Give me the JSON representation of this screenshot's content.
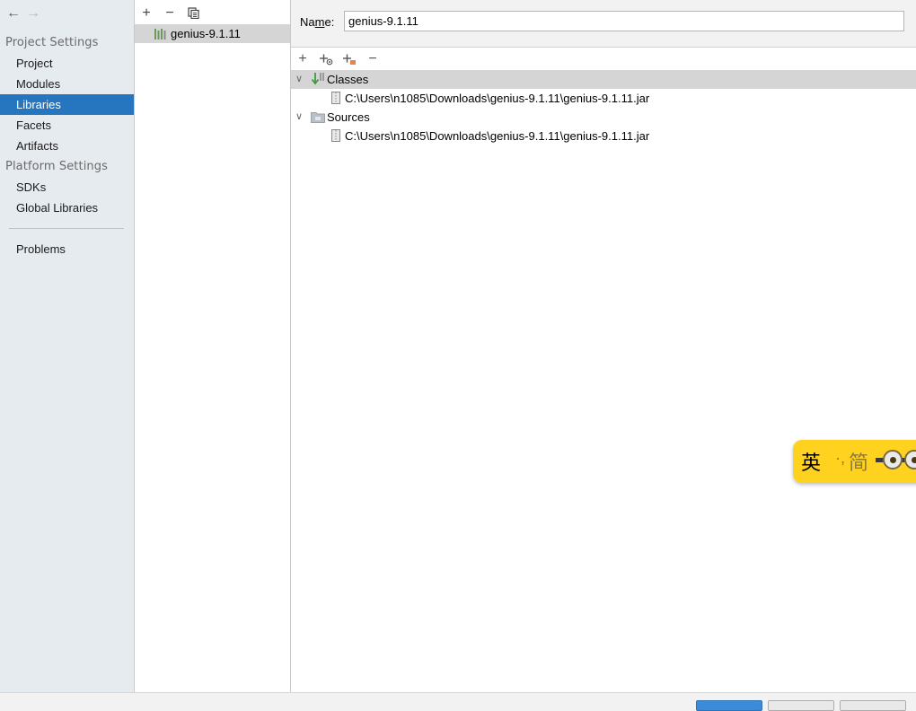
{
  "nav": {
    "back_icon": "arrow-left-icon",
    "forward_icon": "arrow-right-icon",
    "back_glyph": "←",
    "forward_glyph": "→"
  },
  "sidebar": {
    "project_settings_header": "Project Settings",
    "platform_settings_header": "Platform Settings",
    "project_items": [
      "Project",
      "Modules",
      "Libraries",
      "Facets",
      "Artifacts"
    ],
    "platform_items": [
      "SDKs",
      "Global Libraries"
    ],
    "problems": "Problems",
    "selected": "Libraries"
  },
  "libraries": {
    "toolbar": {
      "add": "+",
      "remove": "−",
      "copy_icon": "copy-icon"
    },
    "items": [
      "genius-9.1.11"
    ],
    "selected": "genius-9.1.11"
  },
  "detail": {
    "name_label_prefix": "Na",
    "name_label_mnemonic": "m",
    "name_label_suffix": "e:",
    "name_value": "genius-9.1.11",
    "toolbar": {
      "add": "+",
      "add_special_icon": "add-with-badge-icon",
      "add_orange_icon": "add-orange-icon",
      "remove": "−"
    },
    "tree": {
      "classes": {
        "label": "Classes",
        "paths": [
          "C:\\Users\\n1085\\Downloads\\genius-9.1.11\\genius-9.1.11.jar"
        ]
      },
      "sources": {
        "label": "Sources",
        "paths": [
          "C:\\Users\\n1085\\Downloads\\genius-9.1.11\\genius-9.1.11.jar"
        ]
      }
    }
  },
  "ime": {
    "lang": "英",
    "separator": "·,",
    "mode": "简"
  },
  "colors": {
    "selection_blue": "#2675bf",
    "sidebar_bg": "#e6ebf0",
    "ime_yellow": "#ffd21f"
  }
}
